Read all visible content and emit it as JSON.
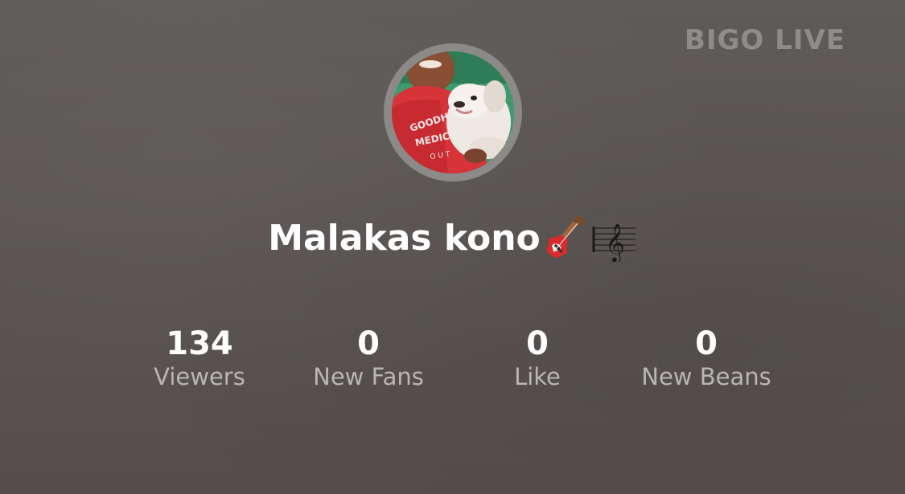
{
  "brand": {
    "logo_text": "BIGO LIVE",
    "logo_color": "#8e8b89"
  },
  "profile": {
    "avatar_icon": "user-photo-with-dog",
    "username": "Malakas kono",
    "emoji_icons": [
      "electric-guitar-emoji",
      "musical-score-emoji"
    ]
  },
  "stats": [
    {
      "value": "134",
      "label": "Viewers"
    },
    {
      "value": "0",
      "label": "New Fans"
    },
    {
      "value": "0",
      "label": "Like"
    },
    {
      "value": "0",
      "label": "New Beans"
    }
  ],
  "colors": {
    "background": "#5a5553",
    "label": "#b9b6b4",
    "value": "#ffffff",
    "avatar_ring": "#8c8a89"
  }
}
